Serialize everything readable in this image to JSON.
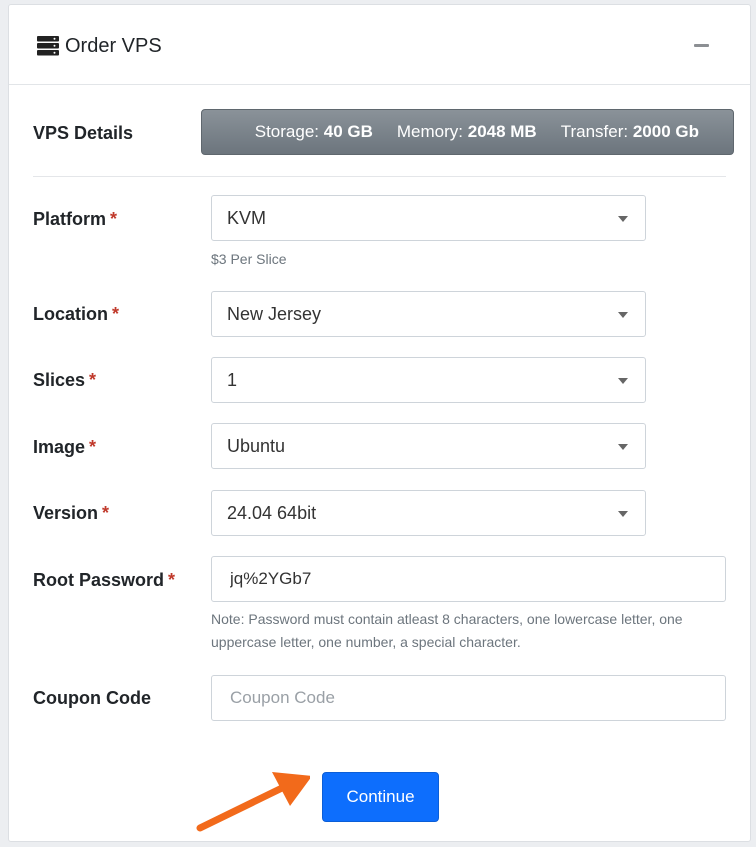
{
  "header": {
    "title": "Order VPS",
    "icon": "server-icon",
    "minimize_icon": "minimize-icon"
  },
  "details": {
    "label": "VPS Details",
    "storage_label": "Storage:",
    "storage_value": "40 GB",
    "memory_label": "Memory:",
    "memory_value": "2048 MB",
    "transfer_label": "Transfer:",
    "transfer_value": "2000 Gb"
  },
  "form": {
    "required_mark": "*",
    "platform": {
      "label": "Platform",
      "value": "KVM",
      "help": "$3 Per Slice"
    },
    "location": {
      "label": "Location",
      "value": "New Jersey"
    },
    "slices": {
      "label": "Slices",
      "value": "1"
    },
    "image": {
      "label": "Image",
      "value": "Ubuntu"
    },
    "version": {
      "label": "Version",
      "value": "24.04 64bit"
    },
    "root_password": {
      "label": "Root Password",
      "value": "jq%2YGb7",
      "note_line1": "Note: Password must contain atleast 8 characters, one lowercase letter, one",
      "note_line2": "uppercase letter, one number, a special character."
    },
    "coupon": {
      "label": "Coupon Code",
      "placeholder": "Coupon Code"
    }
  },
  "actions": {
    "continue_label": "Continue"
  },
  "colors": {
    "primary_button": "#0d6efd",
    "details_bar": "#6c757d",
    "required": "#c0392b",
    "annotation_arrow": "#f26a1b"
  }
}
